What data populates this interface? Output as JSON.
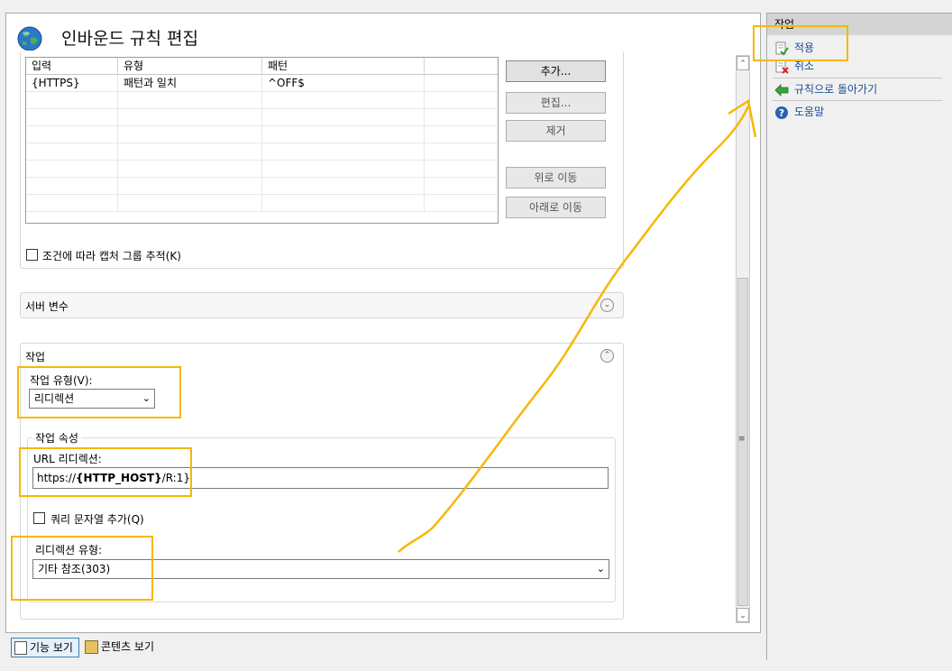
{
  "header": {
    "title": "인바운드 규칙 편집"
  },
  "conditions": {
    "columns": [
      "입력",
      "유형",
      "패턴"
    ],
    "rows": [
      {
        "input": "{HTTPS}",
        "type": "패턴과 일치",
        "pattern": "^OFF$"
      }
    ],
    "buttons": {
      "add": "추가...",
      "edit": "편집...",
      "remove": "제거",
      "move_up": "위로 이동",
      "move_down": "아래로 이동"
    },
    "track_capture_label": "조건에 따라 캡처 그룹 추적(K)"
  },
  "server_variables": {
    "title": "서버 변수"
  },
  "action": {
    "title": "작업",
    "action_type_label": "작업 유형(V):",
    "action_type_value": "리디렉션",
    "properties_legend": "작업 속성",
    "redirect_url_label": "URL 리디렉션:",
    "redirect_url_prefix": "https://",
    "redirect_url_bold": "{HTTP_HOST}",
    "redirect_url_suffix": "/R:1}",
    "append_query_label": "쿼리 문자열 추가(Q)",
    "redirect_type_label": "리디렉션 유형:",
    "redirect_type_value": "기타 참조(303)"
  },
  "actions_pane": {
    "title": "작업",
    "items": [
      {
        "label": "적용",
        "icon": "apply-icon"
      },
      {
        "label": "취소",
        "icon": "cancel-icon"
      },
      {
        "label": "규칙으로 돌아가기",
        "icon": "back-arrow-icon"
      },
      {
        "label": "도움말",
        "icon": "help-icon"
      }
    ]
  },
  "bottom_tabs": {
    "features_view": "기능 보기",
    "content_view": "콘텐츠 보기"
  },
  "colors": {
    "highlight": "#f5b800",
    "link": "#1a4d99"
  }
}
